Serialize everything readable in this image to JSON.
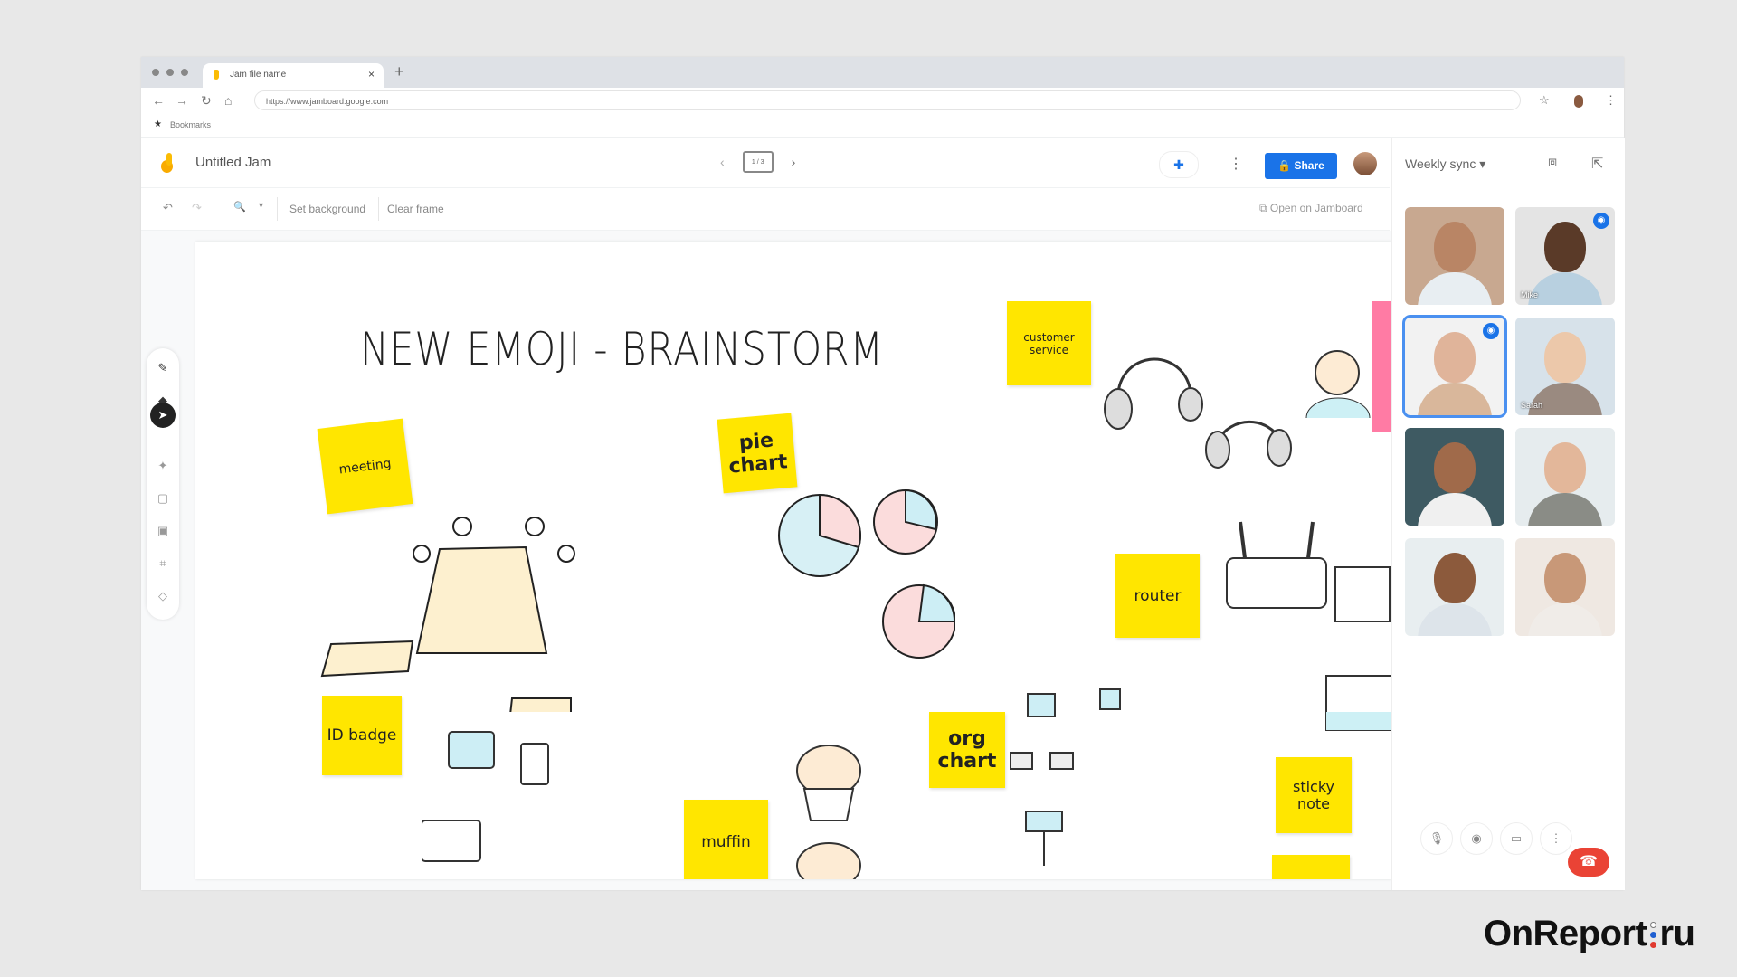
{
  "browser": {
    "tab_title": "Jam file name",
    "tab_close": "×",
    "new_tab": "+",
    "url": "https://www.jamboard.google.com",
    "bookmarks_label": "Bookmarks",
    "icons": {
      "back": "←",
      "forward": "→",
      "reload": "↻",
      "home": "⌂",
      "star": "☆",
      "menu": "⋮"
    }
  },
  "app": {
    "title": "Untitled Jam",
    "frame_counter": "1 / 3",
    "frame_prev": "‹",
    "frame_next": "›",
    "share_label": "Share",
    "more_icon": "⋮",
    "meet_icon": "✚"
  },
  "toolbar": {
    "undo": "↶",
    "redo": "↷",
    "zoom": "🔍",
    "zoom_dropdown": "▾",
    "set_background": "Set background",
    "clear_frame": "Clear frame",
    "open_in_jamboard": "Open on Jamboard"
  },
  "side_tools": [
    {
      "name": "pen",
      "glyph": "✎"
    },
    {
      "name": "eraser",
      "glyph": "◆"
    },
    {
      "name": "select",
      "glyph": "➤",
      "selected": true
    },
    {
      "name": "laser",
      "glyph": "✦"
    },
    {
      "name": "sticky-note",
      "glyph": "▢"
    },
    {
      "name": "image",
      "glyph": "▣"
    },
    {
      "name": "shape",
      "glyph": "⌗"
    },
    {
      "name": "text-box",
      "glyph": "◇"
    }
  ],
  "board": {
    "heading": "NEW EMOJI - BRAINSTORM",
    "stickies": [
      {
        "id": "meeting",
        "text": "meeting"
      },
      {
        "id": "pie-chart",
        "text": "pie chart"
      },
      {
        "id": "customer-service",
        "text": "customer service"
      },
      {
        "id": "router",
        "text": "router"
      },
      {
        "id": "id-badge",
        "text": "ID badge"
      },
      {
        "id": "org-chart",
        "text": "org chart"
      },
      {
        "id": "muffin",
        "text": "muffin"
      },
      {
        "id": "sticky-note",
        "text": "sticky note"
      }
    ]
  },
  "meet": {
    "title": "Weekly sync",
    "dropdown": "▾",
    "participants": [
      {
        "name": "",
        "active": false,
        "badge": false,
        "skin": "#b98565",
        "bg": "#c8a890",
        "shirt": "#e8eef2"
      },
      {
        "name": "Mike",
        "active": false,
        "badge": true,
        "skin": "#5a3a28",
        "bg": "#e4e4e4",
        "shirt": "#b8d0e0"
      },
      {
        "name": "",
        "active": true,
        "badge": true,
        "skin": "#e0b49a",
        "bg": "#f2f2f2",
        "shirt": "#d9b79b"
      },
      {
        "name": "Sarah",
        "active": false,
        "badge": false,
        "skin": "#ecc8aa",
        "bg": "#d7e2ea",
        "shirt": "#9a8a80"
      },
      {
        "name": "",
        "active": false,
        "badge": false,
        "skin": "#a06a4a",
        "bg": "#3e5a62",
        "shirt": "#f0f0f0"
      },
      {
        "name": "",
        "active": false,
        "badge": false,
        "skin": "#e3b79a",
        "bg": "#e6ecee",
        "shirt": "#8a8c86"
      },
      {
        "name": "",
        "active": false,
        "badge": false,
        "skin": "#8c5a3c",
        "bg": "#e8eef0",
        "shirt": "#dde4ea"
      },
      {
        "name": "",
        "active": false,
        "badge": false,
        "skin": "#c89878",
        "bg": "#efe8e2",
        "shirt": "#f0ece8"
      }
    ],
    "controls": {
      "mic": "🎙",
      "camera": "◉",
      "present": "▭",
      "more": "⋮",
      "hangup": "☎"
    }
  },
  "watermark": {
    "left": "OnReport",
    "right": "ru"
  },
  "colors": {
    "accent": "#1a73e8",
    "sticky": "#ffe600",
    "hangup": "#ea4335",
    "pink": "#ff7ba4"
  }
}
